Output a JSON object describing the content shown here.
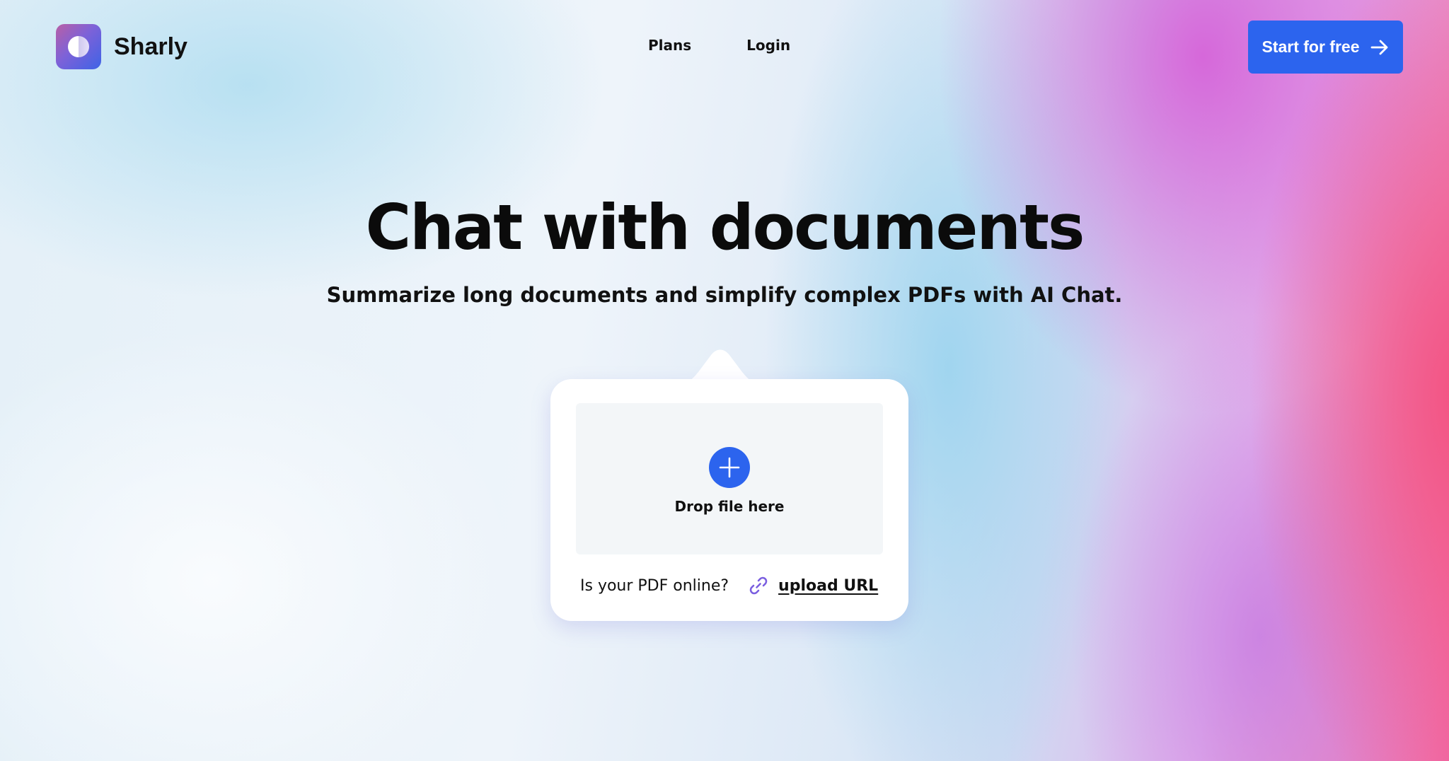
{
  "header": {
    "brand": "Sharly",
    "nav": [
      {
        "label": "Plans"
      },
      {
        "label": "Login"
      }
    ],
    "cta_label": "Start for free"
  },
  "hero": {
    "title": "Chat with documents",
    "subtitle": "Summarize long documents and simplify complex PDFs with AI Chat."
  },
  "upload": {
    "drop_label": "Drop file here",
    "url_question": "Is your PDF online?",
    "url_link": "upload URL"
  },
  "colors": {
    "accent": "#2C64EE",
    "link_icon": "#7B5FE0",
    "text": "#111111",
    "card": "#FFFFFF",
    "drop_zone": "#F3F6F8"
  },
  "icons": {
    "logo": "logo-mark-icon",
    "cta": "arrow-right-icon",
    "add": "plus-icon",
    "link": "link-icon"
  }
}
